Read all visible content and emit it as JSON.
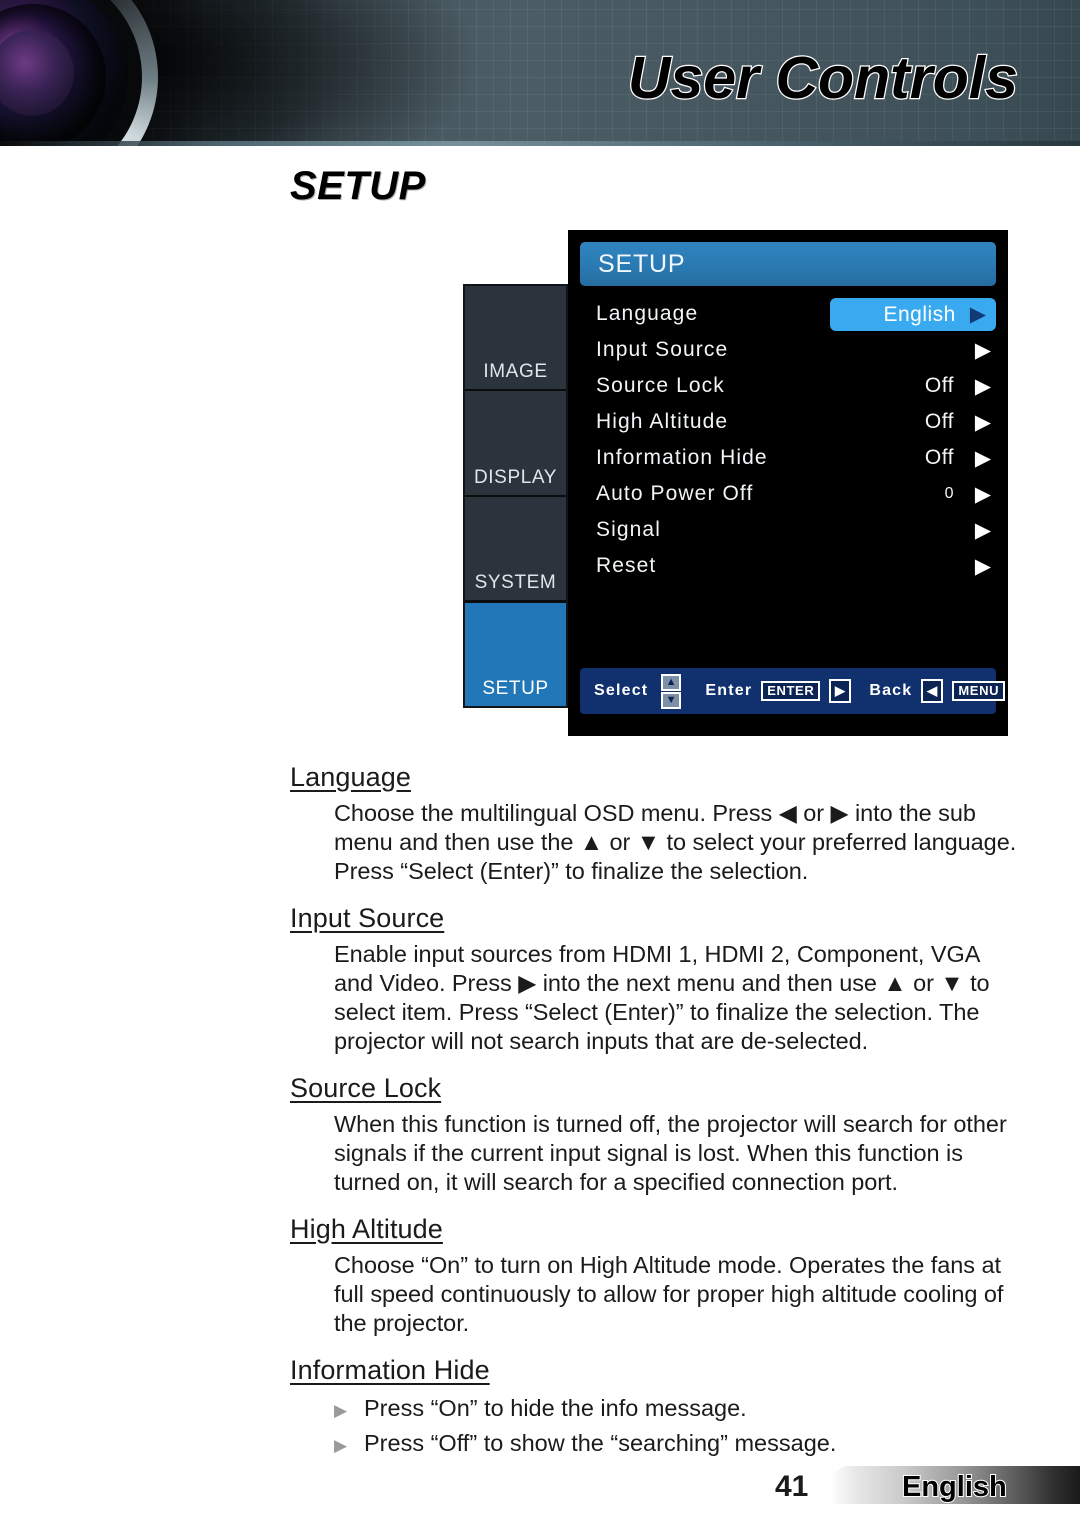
{
  "header": {
    "banner_title": "User Controls",
    "lens_icon": "camera-lens-graphic"
  },
  "page_title": "SETUP",
  "osd": {
    "title": "SETUP",
    "tabs": [
      {
        "label": "IMAGE",
        "active": false
      },
      {
        "label": "DISPLAY",
        "active": false
      },
      {
        "label": "SYSTEM",
        "active": false
      },
      {
        "label": "SETUP",
        "active": true
      }
    ],
    "rows": [
      {
        "label": "Language",
        "value": "English",
        "highlighted": true,
        "arrow": "▶"
      },
      {
        "label": "Input Source",
        "value": "",
        "highlighted": false,
        "arrow": "▶"
      },
      {
        "label": "Source Lock",
        "value": "Off",
        "highlighted": false,
        "arrow": "▶"
      },
      {
        "label": "High Altitude",
        "value": "Off",
        "highlighted": false,
        "arrow": "▶"
      },
      {
        "label": "Information Hide",
        "value": "Off",
        "highlighted": false,
        "arrow": "▶"
      },
      {
        "label": "Auto Power Off",
        "value": "0",
        "highlighted": false,
        "arrow": "▶"
      },
      {
        "label": "Signal",
        "value": "",
        "highlighted": false,
        "arrow": "▶"
      },
      {
        "label": "Reset",
        "value": "",
        "highlighted": false,
        "arrow": "▶"
      }
    ],
    "hint_bar": {
      "select_label": "Select",
      "up_key": "▲",
      "down_key": "▼",
      "enter_label": "Enter",
      "enter_key": "ENTER",
      "enter_arrow": "▶",
      "back_label": "Back",
      "back_arrow": "◀",
      "menu_key": "MENU"
    }
  },
  "sections": [
    {
      "heading": "Language",
      "body": "Choose the multilingual OSD menu. Press ◀ or ▶ into the sub menu and then use the ▲ or ▼ to select your preferred language. Press “Select (Enter)” to finalize the selection."
    },
    {
      "heading": "Input Source",
      "body": "Enable input sources from HDMI 1, HDMI 2, Component, VGA and Video. Press ▶ into the next menu and then use ▲ or ▼ to select item. Press “Select (Enter)” to finalize the selection. The projector will not search inputs that are de-selected."
    },
    {
      "heading": "Source Lock",
      "body": "When this function is turned off, the projector will search for other signals if the current input signal is lost. When this function is turned on, it will search for a specified connection port."
    },
    {
      "heading": "High Altitude",
      "body": "Choose “On” to turn on High Altitude mode. Operates the fans at full speed continuously to allow for proper high altitude cooling of the projector."
    }
  ],
  "information_hide": {
    "heading": "Information Hide",
    "bullet_mark": "▶",
    "bullets": [
      "Press “On” to hide the info message.",
      "Press “Off” to show the “searching” message."
    ]
  },
  "footer": {
    "page_number": "41",
    "language": "English"
  },
  "colors": {
    "osd_header_blue": "#2a7ab2",
    "osd_highlight_blue": "#3aaaf0",
    "osd_tab_active": "#2277b8",
    "osd_tab_inactive": "#2b343c",
    "osd_hint_bar": "#10306e",
    "header_banner": "#4c5c64"
  }
}
